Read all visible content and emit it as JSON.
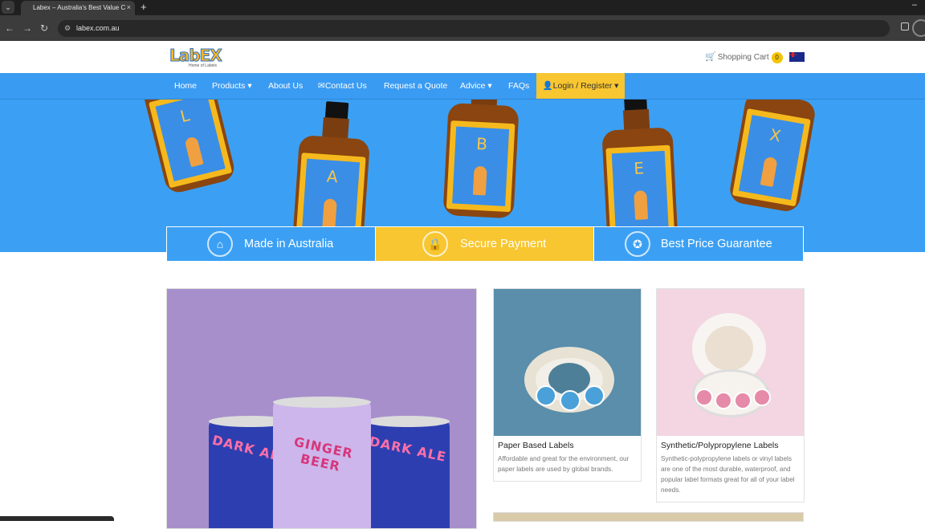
{
  "browser": {
    "tab_title": "Labex – Australia's Best Value C",
    "tab_close": "×",
    "new_tab": "+",
    "url": "labex.com.au",
    "back": "←",
    "forward": "→",
    "reload": "↻"
  },
  "header": {
    "logo_text": "LabEX",
    "logo_tagline": "Home of Labels",
    "cart_label": "Shopping Cart",
    "cart_count": "0"
  },
  "nav": {
    "items": [
      "Home",
      "Products ▾",
      "About Us",
      "Contact Us",
      "Request a Quote",
      "Advice ▾",
      "FAQs"
    ],
    "login": "Login / Register ▾"
  },
  "hero": {
    "bottle_letters": [
      "L",
      "A",
      "B",
      "E",
      "X"
    ]
  },
  "features": [
    {
      "label": "Made in Australia",
      "icon": "australia-map-icon"
    },
    {
      "label": "Secure Payment",
      "icon": "padlock-icon"
    },
    {
      "label": "Best Price Guarantee",
      "icon": "medal-icon"
    }
  ],
  "products": {
    "featured_can_labels": [
      "DARK ALE",
      "GINGER BEER",
      "DARK ALE"
    ],
    "cards": [
      {
        "title": "Paper Based Labels",
        "text": "Affordable and great for the environment, our paper labels are used by global brands."
      },
      {
        "title": "Synthetic/Polypropylene Labels",
        "text": "Synthetic-polypropylene labels or vinyl labels are one of the most durable, waterproof, and popular label formats great for all of your label needs."
      }
    ]
  },
  "colors": {
    "nav_blue": "#3a9bf2",
    "accent_yellow": "#f8c630"
  }
}
